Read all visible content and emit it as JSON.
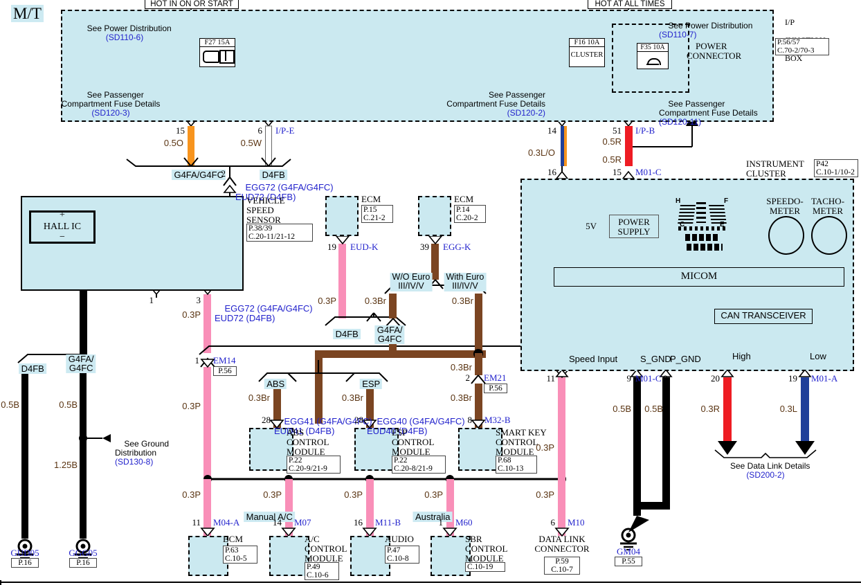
{
  "diagram": {
    "transmission_label": "M/T",
    "source_labels": {
      "left": "HOT IN ON OR START",
      "right": "HOT AT ALL TIMES"
    },
    "junction_box": {
      "title_line1": "I/P",
      "title_line2": "JUNCTION",
      "title_line3": "BOX",
      "ref_line1": "P.56/57",
      "ref_line2": "C.70-2/70-3"
    },
    "power_connector_label_line1": "POWER",
    "power_connector_label_line2": "CONNECTOR",
    "fuses": [
      {
        "id": "fuse-f27",
        "name": "F27 15A",
        "desc": ""
      },
      {
        "id": "fuse-f16",
        "name": "F16 10A",
        "desc": "CLUSTER"
      },
      {
        "id": "fuse-f35",
        "name": "F35 10A",
        "desc": ""
      }
    ],
    "references": [
      {
        "id": "ref-sd110-6",
        "line1": "See Power Distribution",
        "code": "(SD110-6)"
      },
      {
        "id": "ref-sd120-3",
        "line1": "See Passenger",
        "line2": "Compartment Fuse Details",
        "code": "(SD120-3)"
      },
      {
        "id": "ref-sd120-2",
        "line1": "See Passenger",
        "line2": "Compartment Fuse Details",
        "code": "(SD120-2)"
      },
      {
        "id": "ref-sd110-7",
        "line1": "See Power Distribution",
        "code": "(SD110-7)"
      },
      {
        "id": "ref-sd120-11",
        "line1": "See Passenger",
        "line2": "Compartment Fuse Details",
        "code": "(SD120-11)"
      },
      {
        "id": "ref-sd130-8",
        "line1": "See Ground",
        "line2": "Distribution",
        "code": "(SD130-8)"
      },
      {
        "id": "ref-sd200-2",
        "line1": "See Data Link Details",
        "code": "(SD200-2)"
      }
    ],
    "pins": {
      "p15": "15",
      "p6": "6",
      "p14": "14",
      "p51": "51",
      "p16": "16",
      "p15b": "15",
      "p2": "2",
      "p1": "1",
      "p3": "3",
      "p19": "19",
      "p39": "39",
      "p1_em14": "1",
      "p2_em21": "2",
      "p28a": "28",
      "p28b": "28",
      "p8": "8",
      "p11a": "11",
      "p14b": "14",
      "p16b": "16",
      "p1b": "1",
      "p6b": "6",
      "p11c": "11",
      "p9": "9",
      "p8b": "8",
      "p20": "20",
      "p19b": "19"
    },
    "connector_names": {
      "ipe": "I/P-E",
      "ipb": "I/P-B",
      "m01c_top": "M01-C",
      "eudk": "EUD-K",
      "eggk": "EGG-K",
      "em14": "EM14",
      "em21": "EM21",
      "m32b": "M32-B",
      "m04a": "M04-A",
      "m07": "M07",
      "m11b": "M11-B",
      "m60": "M60",
      "m10": "M10",
      "m01c": "M01-C",
      "m01a": "M01-A"
    },
    "wire_specs": {
      "w050O": "0.5O",
      "w05W": "0.5W",
      "w03LO": "0.3L/O",
      "w05R_a": "0.5R",
      "w05R_b": "0.5R",
      "w03P_vss": "0.3P",
      "w03P_em14": "0.3P",
      "w05B_d4fb": "0.5B",
      "w05B_g4fa": "0.5B",
      "w125B": "1.25B",
      "w03P_eud": "0.3P",
      "w03Br_a": "0.3Br",
      "w03Br_b": "0.3Br",
      "w03Br_c": "0.3Br",
      "w03Br_d": "0.3Br",
      "w03Br_abs": "0.3Br",
      "w03Br_esp": "0.3Br",
      "w03Br_skm": "0.3Br",
      "w03P_1": "0.3P",
      "w03P_2": "0.3P",
      "w03P_3": "0.3P",
      "w03P_4": "0.3P",
      "w03P_5": "0.3P",
      "w03P_dlc": "0.3P",
      "w05B_sgnd": "0.5B",
      "w05B_pgnd": "0.5B",
      "w03R": "0.3R",
      "w03L": "0.3L"
    },
    "splice_labels": {
      "g4fa_g4fc_top": "G4FA/G4FC",
      "d4fb_top": "D4FB",
      "d4fb_left": "D4FB",
      "g4fa_g4fc_left": "G4FA/\nG4FC",
      "d4fb_mid": "D4FB",
      "g4fa_g4fc_mid": "G4FA/\nG4FC",
      "wo_euro": "W/O Euro\nIII/IV/V",
      "with_euro": "With Euro\nIII/IV/V",
      "abs": "ABS",
      "esp": "ESP",
      "manual_ac": "Manual A/C",
      "australia": "Australia"
    },
    "circuit_codes": {
      "vss_top_line1": "EGG72 (G4FA/G4FC)",
      "vss_top_line2": "EUD72 (D4FB)",
      "vss_bot_line1": "EGG72 (G4FA/G4FC)",
      "vss_bot_line2": "EUD72 (D4FB)",
      "abs_line1": "EGG41 (G4FA/G4FC)",
      "abs_line2": "EUD41 (D4FB)",
      "esp_line1": "EGG40 (G4FA/G4FC)",
      "esp_line2": "EUD40 (D4FB)"
    },
    "modules": [
      {
        "id": "vehicle-speed-sensor",
        "name": "VEHICLE\nSPEED\nSENSOR",
        "ref1": "P.38/39",
        "ref2": "C.20-11/21-12"
      },
      {
        "id": "ecm-left",
        "name": "ECM",
        "ref1": "P.15",
        "ref2": "C.21-2"
      },
      {
        "id": "ecm-right",
        "name": "ECM",
        "ref1": "P.14",
        "ref2": "C.20-2"
      },
      {
        "id": "abs-control-module",
        "name": "ABS\nCONTROL\nMODULE",
        "ref1": "P.22",
        "ref2": "C.20-9/21-9"
      },
      {
        "id": "esp-control-module",
        "name": "ESP\nCONTROL\nMODULE",
        "ref1": "P.22",
        "ref2": "C.20-8/21-9"
      },
      {
        "id": "smart-key-control-module",
        "name": "SMART KEY\nCONTROL\nMODULE",
        "ref1": "P.68",
        "ref2": "C.10-13"
      },
      {
        "id": "bcm",
        "name": "BCM",
        "ref1": "P.63",
        "ref2": "C.10-5"
      },
      {
        "id": "ac-control-module",
        "name": "A/C\nCONTROL\nMODULE",
        "ref1": "P.49",
        "ref2": "C.10-6"
      },
      {
        "id": "audio",
        "name": "AUDIO",
        "ref1": "P.47",
        "ref2": "C.10-8"
      },
      {
        "id": "sbr-control-module",
        "name": "SBR\nCONTROL\nMODULE",
        "ref1": "C.10-19",
        "ref2": ""
      },
      {
        "id": "data-link-connector",
        "name": "DATA LINK\nCONNECTOR",
        "ref1": "P.59",
        "ref2": "C.10-7"
      }
    ],
    "instrument_cluster": {
      "title": "INSTRUMENT\nCLUSTER",
      "ref1": "P42",
      "ref2": "C.10-1/10-2",
      "power_supply": "POWER\nSUPPLY",
      "voltage": "5V",
      "micom": "MICOM",
      "can_transceiver": "CAN TRANSCEIVER",
      "speedometer": "SPEEDO-\nMETER",
      "tachometer": "TACHO-\nMETER",
      "signals": {
        "speed_input": "Speed Input",
        "s_gnd": "S_GND",
        "p_gnd": "P_GND",
        "high": "High",
        "low": "Low"
      },
      "gauge_marks": {
        "h": "H",
        "f": "F",
        "c": "C",
        "e": "E"
      }
    },
    "hall_ic": {
      "label": "HALL IC",
      "plus": "+",
      "minus": "−"
    },
    "grounds": [
      {
        "id": "ground-gud05",
        "name": "GUD05",
        "ref": "P.16"
      },
      {
        "id": "ground-ggg05",
        "name": "GGG05",
        "ref": "P.16"
      },
      {
        "id": "ground-gm04",
        "name": "GM04",
        "ref": "P.55"
      }
    ],
    "colors": {
      "region_fill": "#cbe9f0",
      "wire_orange": "#f7941e",
      "wire_pink": "#f98fb8",
      "wire_brown": "#7b4522",
      "wire_red": "#ee1c23",
      "wire_blue": "#1f3f99",
      "wire_black": "#000000",
      "wire_white": "#ffffff",
      "link_blue": "#2222cc"
    }
  }
}
